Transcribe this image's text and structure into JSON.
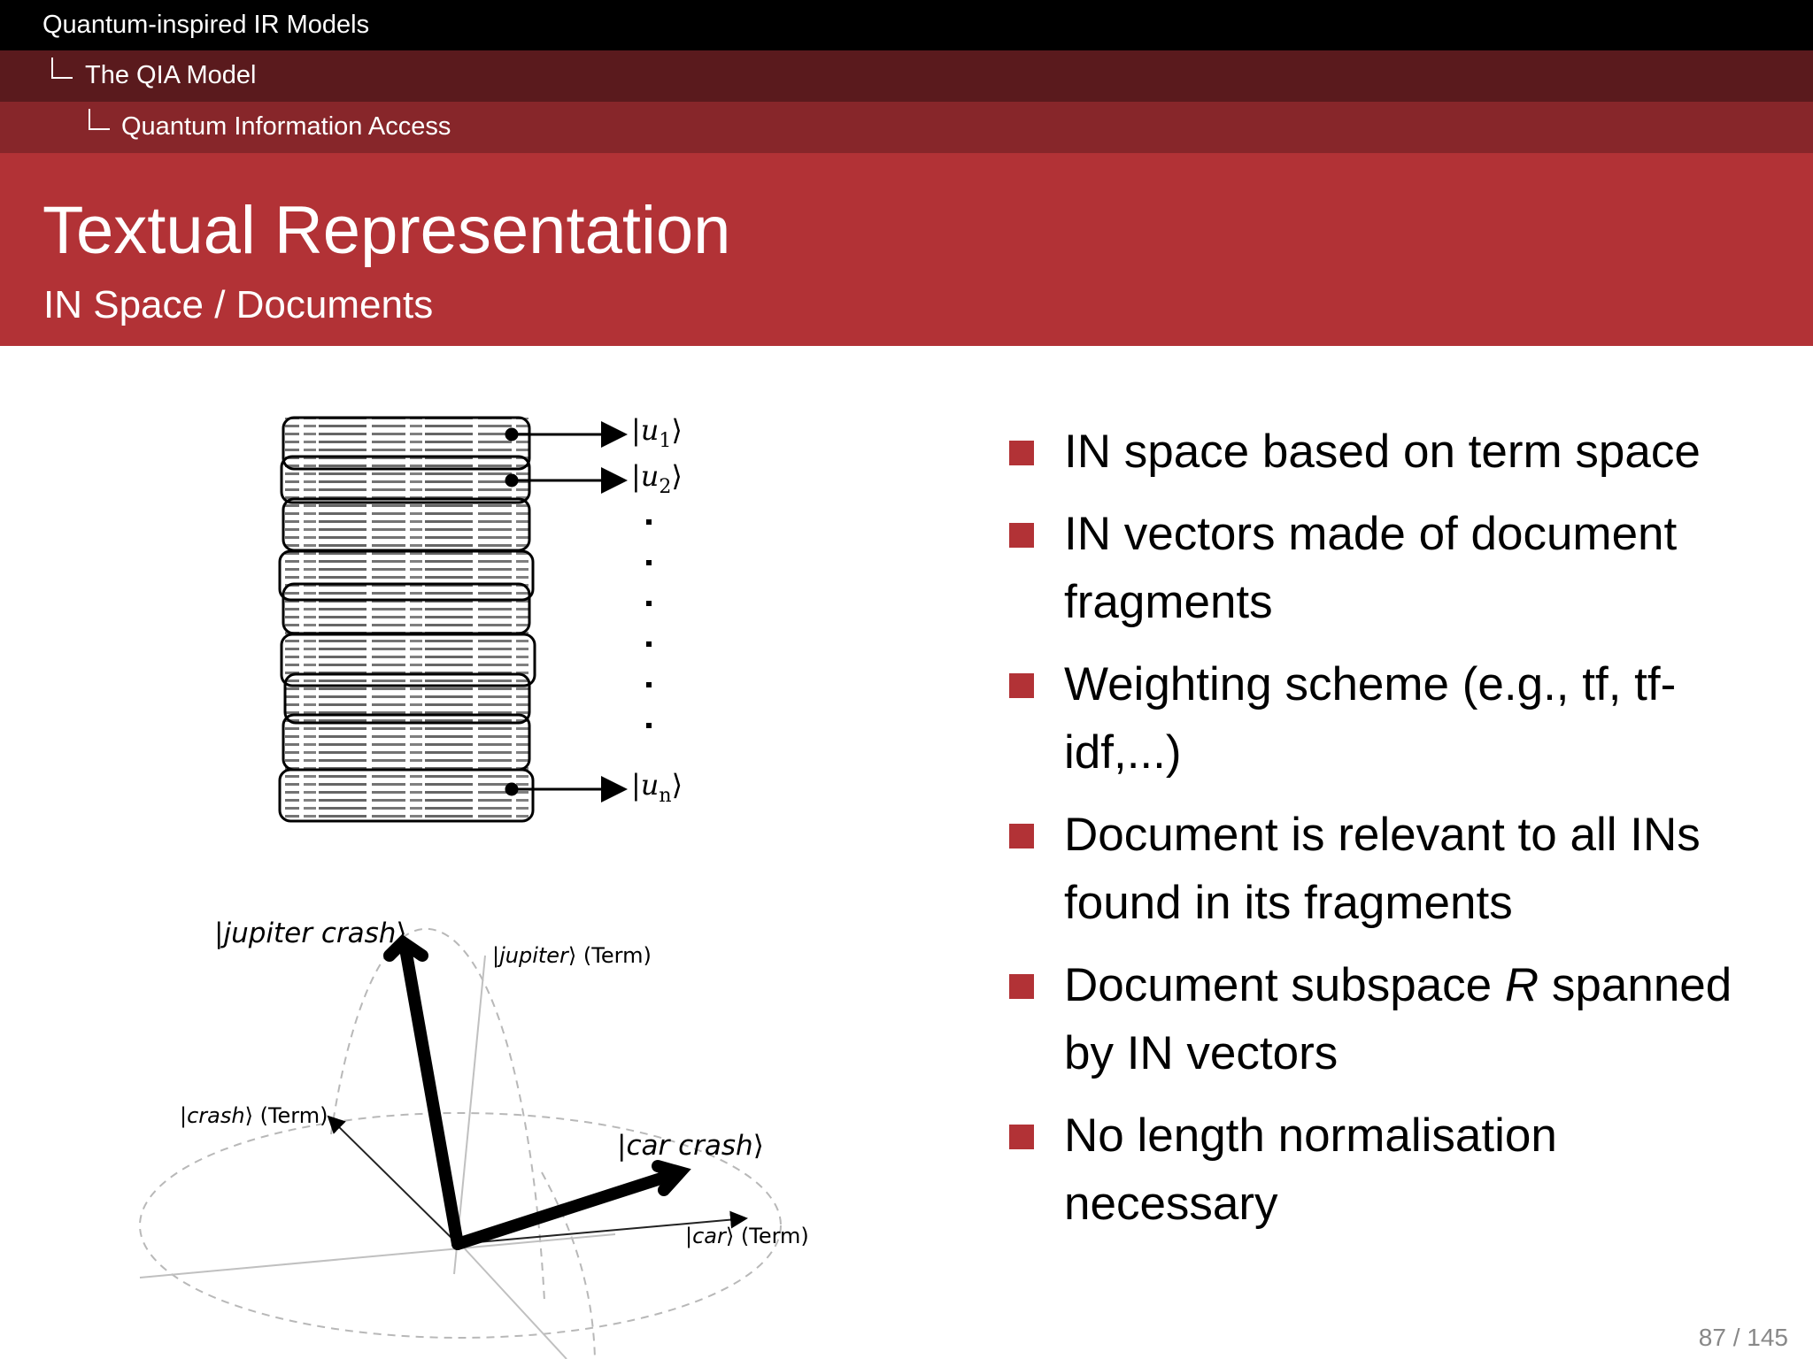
{
  "breadcrumb": {
    "level1": "Quantum-inspired IR Models",
    "level2": "The QIA Model",
    "level3": "Quantum Information Access"
  },
  "slide": {
    "title": "Textual Representation",
    "subtitle": "IN Space / Documents"
  },
  "bullets": [
    {
      "text": "IN space based on term space"
    },
    {
      "text": "IN vectors made of document fragments"
    },
    {
      "text": "Weighting scheme (e.g., tf, tf-idf,...)"
    },
    {
      "text": "Document is relevant to all INs found in its fragments"
    },
    {
      "text": "Document subspace ",
      "italic": "R",
      "rest": " spanned by IN vectors"
    },
    {
      "text": "No length normalisation necessary"
    }
  ],
  "fragments_figure": {
    "labels": [
      "u",
      "u",
      "u"
    ],
    "subscripts": [
      "1",
      "2",
      "n"
    ]
  },
  "vector_figure": {
    "jupiter_crash": "jupiter crash",
    "jupiter_term": "jupiter",
    "crash_term": "crash",
    "car_crash": "car crash",
    "car_term": "car",
    "term_suffix": "(Term)"
  },
  "footer": {
    "page": "87 / 145"
  },
  "colors": {
    "accent": "#b23236",
    "header_dark": "#5a1a1d",
    "header_mid": "#87262a"
  }
}
